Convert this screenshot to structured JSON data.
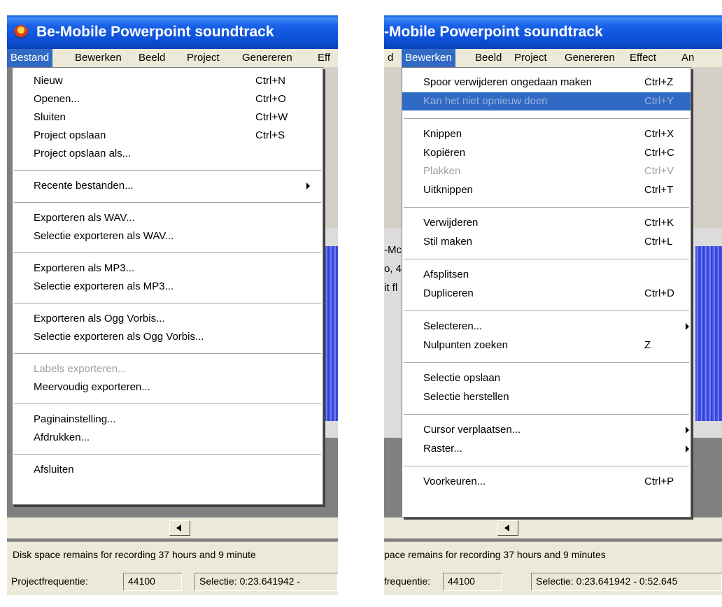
{
  "left": {
    "title": "Be-Mobile Powerpoint soundtrack",
    "menubar": [
      "Bestand",
      "Bewerken",
      "Beeld",
      "Project",
      "Genereren",
      "Eff"
    ],
    "menu": [
      {
        "label": "Nieuw",
        "shortcut": "Ctrl+N"
      },
      {
        "label": "Openen...",
        "shortcut": "Ctrl+O"
      },
      {
        "label": "Sluiten",
        "shortcut": "Ctrl+W"
      },
      {
        "label": "Project opslaan",
        "shortcut": "Ctrl+S"
      },
      {
        "label": "Project opslaan als...",
        "shortcut": ""
      },
      {
        "sep": true
      },
      {
        "label": "Recente bestanden...",
        "shortcut": "",
        "submenu": true
      },
      {
        "sep": true
      },
      {
        "label": "Exporteren als WAV...",
        "shortcut": ""
      },
      {
        "label": "Selectie exporteren als WAV...",
        "shortcut": ""
      },
      {
        "sep": true
      },
      {
        "label": "Exporteren als MP3...",
        "shortcut": ""
      },
      {
        "label": "Selectie exporteren als MP3...",
        "shortcut": ""
      },
      {
        "sep": true
      },
      {
        "label": "Exporteren als Ogg Vorbis...",
        "shortcut": ""
      },
      {
        "label": "Selectie exporteren als Ogg Vorbis...",
        "shortcut": ""
      },
      {
        "sep": true
      },
      {
        "label": "Labels exporteren...",
        "shortcut": "",
        "disabled": true
      },
      {
        "label": "Meervoudig exporteren...",
        "shortcut": ""
      },
      {
        "sep": true
      },
      {
        "label": "Paginainstelling...",
        "shortcut": ""
      },
      {
        "label": "Afdrukken...",
        "shortcut": ""
      },
      {
        "sep": true
      },
      {
        "label": "Afsluiten",
        "shortcut": ""
      }
    ],
    "status": "Disk space remains for recording 37 hours and 9 minute",
    "freq_label": "Projectfrequentie:",
    "freq_value": "44100",
    "selection": "Selectie: 0:23.641942 -"
  },
  "right": {
    "title": "-Mobile Powerpoint soundtrack",
    "menubar": [
      "d",
      "Bewerken",
      "Beeld",
      "Project",
      "Genereren",
      "Effect",
      "An"
    ],
    "menu": [
      {
        "label": "Spoor verwijderen ongedaan maken",
        "shortcut": "Ctrl+Z"
      },
      {
        "label": "Kan het niet opnieuw doen",
        "shortcut": "Ctrl+Y",
        "disabled": true,
        "highlighted": true
      },
      {
        "sep": true
      },
      {
        "label": "Knippen",
        "shortcut": "Ctrl+X"
      },
      {
        "label": "Kopiëren",
        "shortcut": "Ctrl+C"
      },
      {
        "label": "Plakken",
        "shortcut": "Ctrl+V",
        "disabled": true
      },
      {
        "label": "Uitknippen",
        "shortcut": "Ctrl+T"
      },
      {
        "sep": true
      },
      {
        "label": "Verwijderen",
        "shortcut": "Ctrl+K"
      },
      {
        "label": "Stil maken",
        "shortcut": "Ctrl+L"
      },
      {
        "sep": true
      },
      {
        "label": "Afsplitsen",
        "shortcut": ""
      },
      {
        "label": "Dupliceren",
        "shortcut": "Ctrl+D"
      },
      {
        "sep": true
      },
      {
        "label": "Selecteren...",
        "shortcut": "",
        "submenu": true
      },
      {
        "label": "Nulpunten zoeken",
        "shortcut": "Z"
      },
      {
        "sep": true
      },
      {
        "label": "Selectie opslaan",
        "shortcut": ""
      },
      {
        "label": "Selectie herstellen",
        "shortcut": ""
      },
      {
        "sep": true
      },
      {
        "label": "Cursor verplaatsen...",
        "shortcut": "",
        "submenu": true
      },
      {
        "label": "Raster...",
        "shortcut": "",
        "submenu": true
      },
      {
        "sep": true
      },
      {
        "label": "Voorkeuren...",
        "shortcut": "Ctrl+P"
      }
    ],
    "track_info": [
      "-Mc",
      "o, 4",
      "it fl"
    ],
    "status": "pace remains for recording 37 hours and 9 minutes",
    "freq_label": "frequentie:",
    "freq_value": "44100",
    "selection": "Selectie: 0:23.641942 - 0:52.645"
  },
  "colors": {
    "highlight": "#316ac5",
    "titlebar": "#0b4fd6",
    "menu_bg": "#ffffff",
    "bar_bg": "#ece9d8"
  }
}
